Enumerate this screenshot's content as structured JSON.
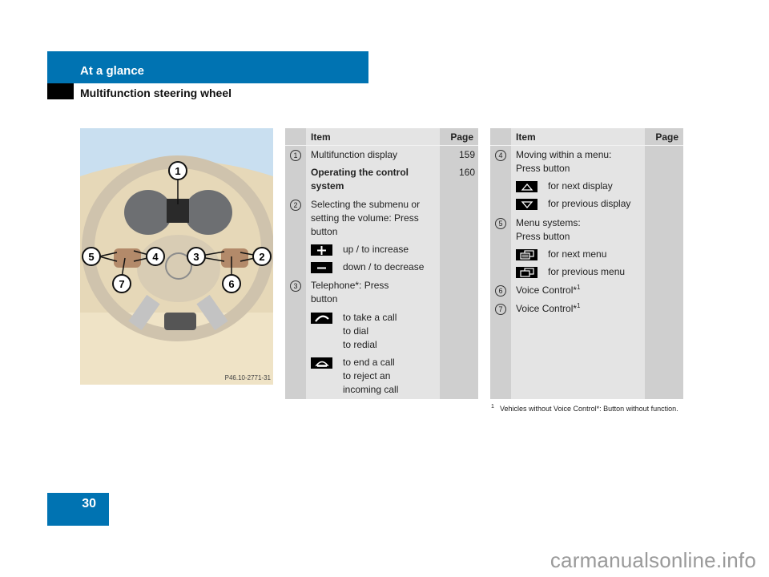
{
  "header": {
    "section_title": "At a glance",
    "subsection_title": "Multifunction steering wheel"
  },
  "page_number": "30",
  "watermark": "carmanualsonline.info",
  "illustration": {
    "code": "P46.10-2771-31",
    "callouts": [
      "1",
      "2",
      "3",
      "4",
      "5",
      "6",
      "7"
    ]
  },
  "colors": {
    "brand_blue": "#0073b2",
    "table_bg": "#e4e4e4",
    "table_col_bg": "#cfcfcf"
  },
  "table_left": {
    "header": {
      "item": "Item",
      "page": "Page"
    },
    "rows": [
      {
        "num": "1",
        "text": "Multifunction display",
        "page": "159"
      },
      {
        "num": "",
        "text": "Operating the control system",
        "page": "160",
        "bold": true
      },
      {
        "num": "2",
        "text": "Selecting the submenu or setting the volume: Press button",
        "page": "",
        "buttons": [
          {
            "icon": "plus-icon",
            "label": "up / to increase"
          },
          {
            "icon": "minus-icon",
            "label": "down / to decrease"
          }
        ]
      },
      {
        "num": "3",
        "text": "Telephone*: Press button",
        "page": "",
        "buttons": [
          {
            "icon": "phone-pickup-icon",
            "label": "to take a call\nto dial\nto redial"
          },
          {
            "icon": "phone-hangup-icon",
            "label": "to end a call\nto reject an\nincoming call"
          }
        ]
      }
    ]
  },
  "table_right": {
    "header": {
      "item": "Item",
      "page": "Page"
    },
    "rows": [
      {
        "num": "4",
        "text": "Moving within a menu: Press button",
        "page": "",
        "buttons": [
          {
            "icon": "arrow-up-icon",
            "label": "for next display"
          },
          {
            "icon": "arrow-down-icon",
            "label": "for previous display"
          }
        ]
      },
      {
        "num": "5",
        "text": "Menu systems: Press button",
        "page": "",
        "buttons": [
          {
            "icon": "next-menu-icon",
            "label": "for next menu"
          },
          {
            "icon": "previous-menu-icon",
            "label": "for previous menu"
          }
        ]
      },
      {
        "num": "6",
        "text": "Voice Control*",
        "footnote_ref": "1",
        "page": ""
      },
      {
        "num": "7",
        "text": "Voice Control*",
        "footnote_ref": "1",
        "page": ""
      }
    ]
  },
  "footnote": {
    "mark": "1",
    "text": "Vehicles without Voice Control*: Button without function."
  }
}
